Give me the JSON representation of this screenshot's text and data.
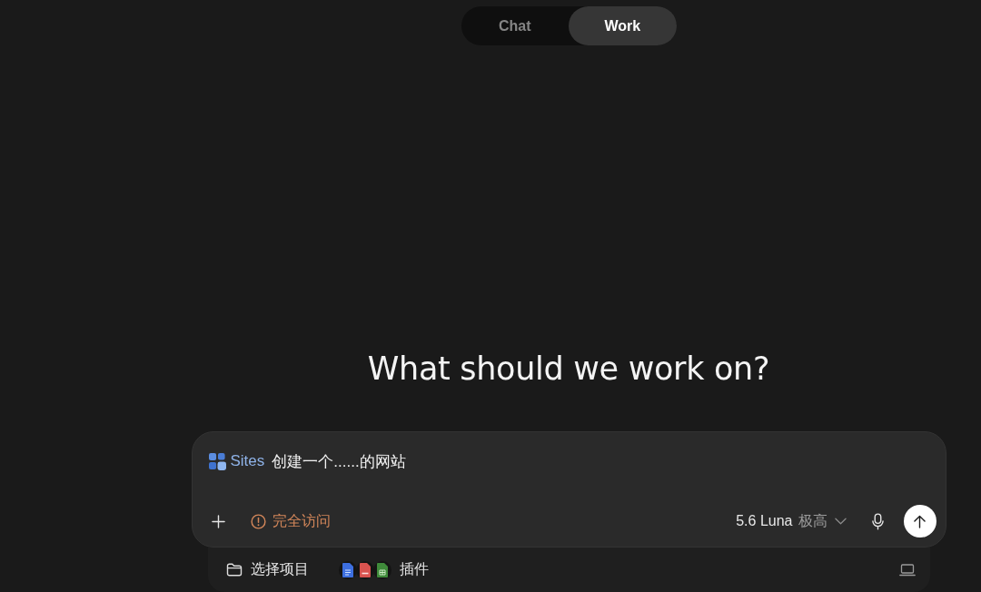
{
  "mode_switch": [
    {
      "label": "Chat",
      "selected": false
    },
    {
      "label": "Work",
      "selected": true
    }
  ],
  "heading": "What should we work on?",
  "composer": {
    "skill_chip": {
      "label": "Sites"
    },
    "value": "创建一个......的网站",
    "access_button": {
      "label": "完全访问"
    },
    "model_selector": {
      "model": "5.6 Luna",
      "effort": "极高"
    }
  },
  "bottom_bar": {
    "project_button": {
      "label": "选择项目"
    },
    "plugins_button": {
      "label": "插件"
    }
  }
}
